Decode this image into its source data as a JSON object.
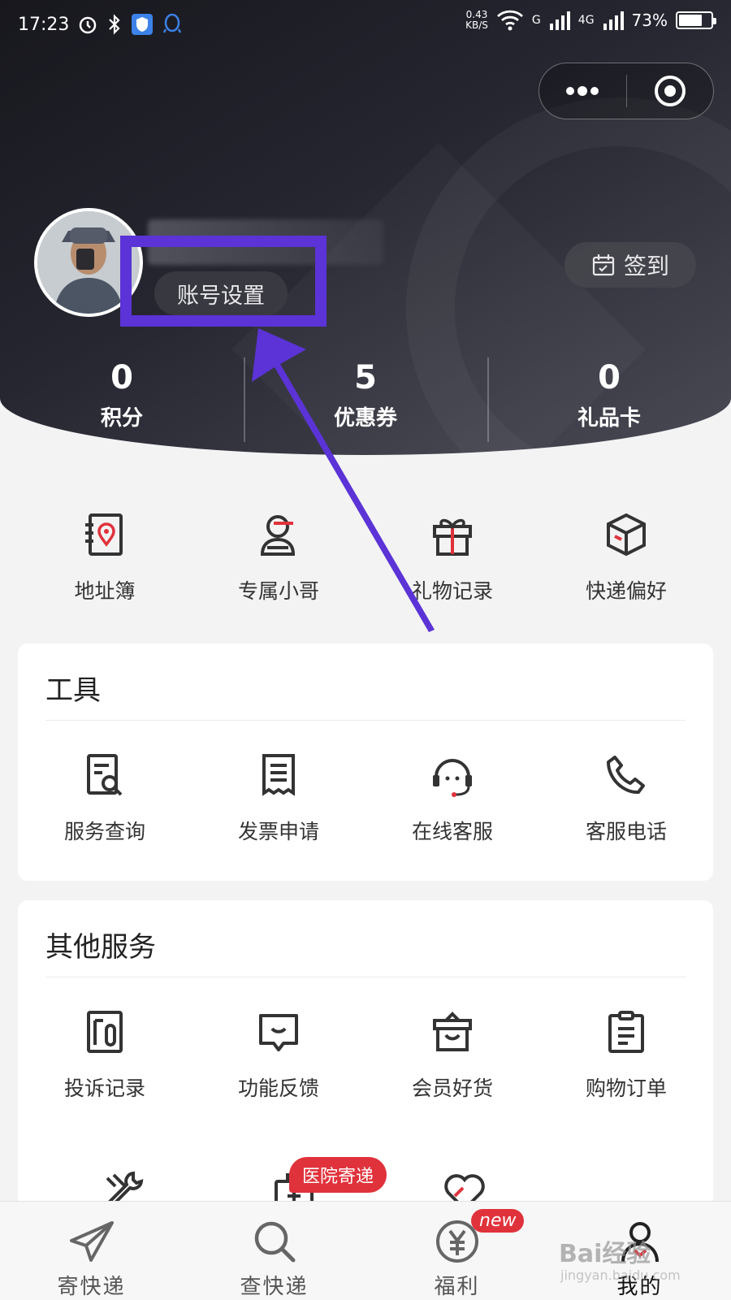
{
  "status_bar": {
    "time": "17:23",
    "net_speed_value": "0.43",
    "net_speed_unit": "KB/S",
    "signal_1": "G",
    "signal_2": "4G",
    "battery": "73%",
    "battery_level": 0.73
  },
  "profile": {
    "account_settings": "账号设置",
    "sign_in": "签到"
  },
  "stats": [
    {
      "value": "0",
      "label": "积分"
    },
    {
      "value": "5",
      "label": "优惠券"
    },
    {
      "value": "0",
      "label": "礼品卡"
    }
  ],
  "quick_actions": [
    {
      "label": "地址簿",
      "icon": "address-book-icon"
    },
    {
      "label": "专属小哥",
      "icon": "courier-icon"
    },
    {
      "label": "礼物记录",
      "icon": "gift-icon"
    },
    {
      "label": "快递偏好",
      "icon": "package-icon"
    }
  ],
  "tools": {
    "title": "工具",
    "items": [
      {
        "label": "服务查询",
        "icon": "service-query-icon"
      },
      {
        "label": "发票申请",
        "icon": "invoice-icon"
      },
      {
        "label": "在线客服",
        "icon": "headset-icon"
      },
      {
        "label": "客服电话",
        "icon": "phone-icon"
      }
    ]
  },
  "other_services": {
    "title": "其他服务",
    "items": [
      {
        "label": "投诉记录",
        "icon": "complaint-icon"
      },
      {
        "label": "功能反馈",
        "icon": "feedback-icon"
      },
      {
        "label": "会员好货",
        "icon": "member-goods-icon"
      },
      {
        "label": "购物订单",
        "icon": "order-icon"
      }
    ],
    "badge": "医院寄递"
  },
  "bottom_nav": [
    {
      "label": "寄快递",
      "icon": "send-icon"
    },
    {
      "label": "查快递",
      "icon": "search-icon"
    },
    {
      "label": "福利",
      "icon": "yen-icon"
    },
    {
      "label": "我的",
      "icon": "profile-icon"
    }
  ],
  "new_badge": "new",
  "watermark": {
    "brand": "Bai经验",
    "domain": "jingyan.baidu.com"
  },
  "colors": {
    "accent": "#e0323b",
    "annotation": "#5b33d6",
    "header_dark": "#1d1d24"
  }
}
